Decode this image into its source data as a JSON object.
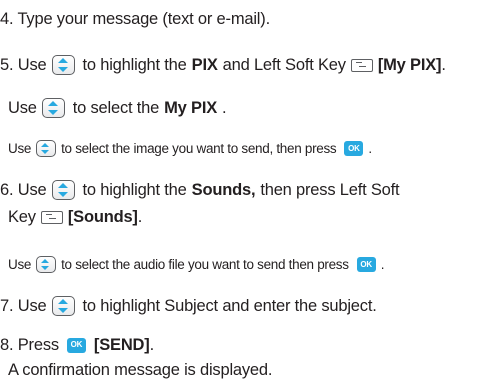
{
  "icons": {
    "nav_key": "navigation-up-down-key-icon",
    "soft_key": "left-soft-key-icon",
    "ok_key": "ok-key-icon"
  },
  "ok_key_text": "OK",
  "colors": {
    "text": "#231f20",
    "accent": "#28a9e0",
    "icon_border": "#5e6063"
  },
  "steps": {
    "s4": {
      "text": "4. Type your message (text or e-mail)."
    },
    "s5": {
      "a": "5. Use",
      "b": "to highlight the",
      "c": "PIX",
      "d": "and Left Soft Key",
      "e": "[My PIX]",
      "f": ".",
      "sub1": {
        "a": "Use",
        "b": "to select the",
        "c": "My PIX",
        "d": "."
      },
      "sub2": {
        "a": "Use",
        "b": "to select the image you want to send, then press",
        "c": "."
      }
    },
    "s6": {
      "a": "6. Use",
      "b": "to highlight the",
      "c": "Sounds,",
      "d": "then press Left Soft",
      "e": "Key",
      "f": "[Sounds]",
      "g": ".",
      "sub1": {
        "a": "Use",
        "b": "to select the audio file you want to send then press",
        "c": "."
      }
    },
    "s7": {
      "a": "7. Use",
      "b": "to highlight Subject and enter the subject."
    },
    "s8": {
      "a": "8. Press",
      "b": "[SEND]",
      "c": ".",
      "d": "A confirmation message is displayed."
    }
  }
}
